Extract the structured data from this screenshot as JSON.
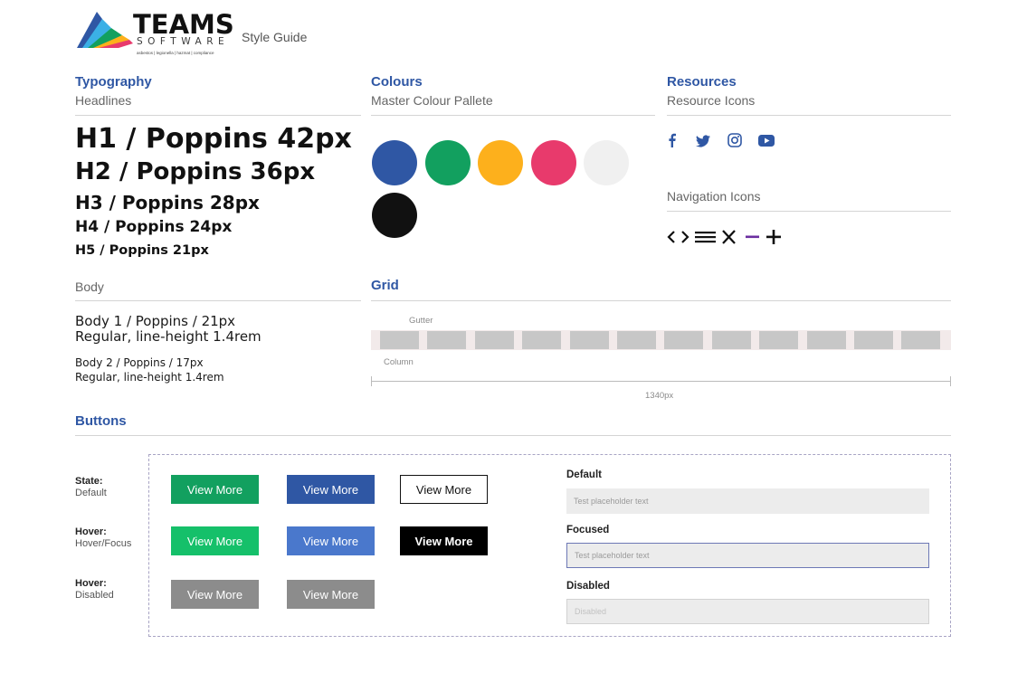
{
  "header": {
    "logo_name": "TEAMS",
    "logo_sub": "SOFTWARE",
    "logo_tagline": "asbestos | legionella | hazmat | compliance",
    "page_label": "Style Guide"
  },
  "typography": {
    "title": "Typography",
    "headlines_label": "Headlines",
    "headlines": [
      "H1 / Poppins 42px",
      "H2 / Poppins 36px",
      "H3 / Poppins 28px",
      "H4 / Poppins 24px",
      "H5 / Poppins 21px"
    ],
    "body_label": "Body",
    "body1_line1": "Body 1 / Poppins / 21px",
    "body1_line2": "Regular, line-height 1.4rem",
    "body2_line1": "Body 2 / Poppins / 17px",
    "body2_line2": "Regular, line-height 1.4rem"
  },
  "colours": {
    "title": "Colours",
    "subtitle": "Master Colour Pallete",
    "swatches": [
      "#2f57a4",
      "#12a05f",
      "#fdb01c",
      "#e83a6c",
      "#f0f0f0",
      "#111111"
    ]
  },
  "resources": {
    "title": "Resources",
    "subtitle": "Resource Icons",
    "social_icons": [
      "facebook-icon",
      "twitter-icon",
      "instagram-icon",
      "youtube-icon"
    ],
    "nav_label": "Navigation Icons",
    "nav_icons": [
      "chevron-left-right-icon",
      "menu-icon",
      "close-icon",
      "minus-icon",
      "plus-icon"
    ],
    "minus_color": "#6b2fa0"
  },
  "grid": {
    "title": "Grid",
    "gutter_label": "Gutter",
    "column_label": "Column",
    "width_label": "1340px",
    "column_count": 12
  },
  "buttons": {
    "title": "Buttons",
    "states": [
      {
        "label": "State:",
        "sub": "Default"
      },
      {
        "label": "Hover:",
        "sub": "Hover/Focus"
      },
      {
        "label": "Hover:",
        "sub": "Disabled"
      }
    ],
    "button_label": "View More",
    "colors": {
      "green": "#12a05f",
      "blue": "#2f57a4",
      "green_hover": "#15c06a",
      "blue_hover": "#4a78cc",
      "disabled": "#8c8c8c",
      "black": "#000000"
    }
  },
  "fields": {
    "default_label": "Default",
    "default_placeholder": "Test placeholder text",
    "focused_label": "Focused",
    "focused_placeholder": "Test placeholder text",
    "disabled_label": "Disabled",
    "disabled_placeholder": "Disabled"
  }
}
